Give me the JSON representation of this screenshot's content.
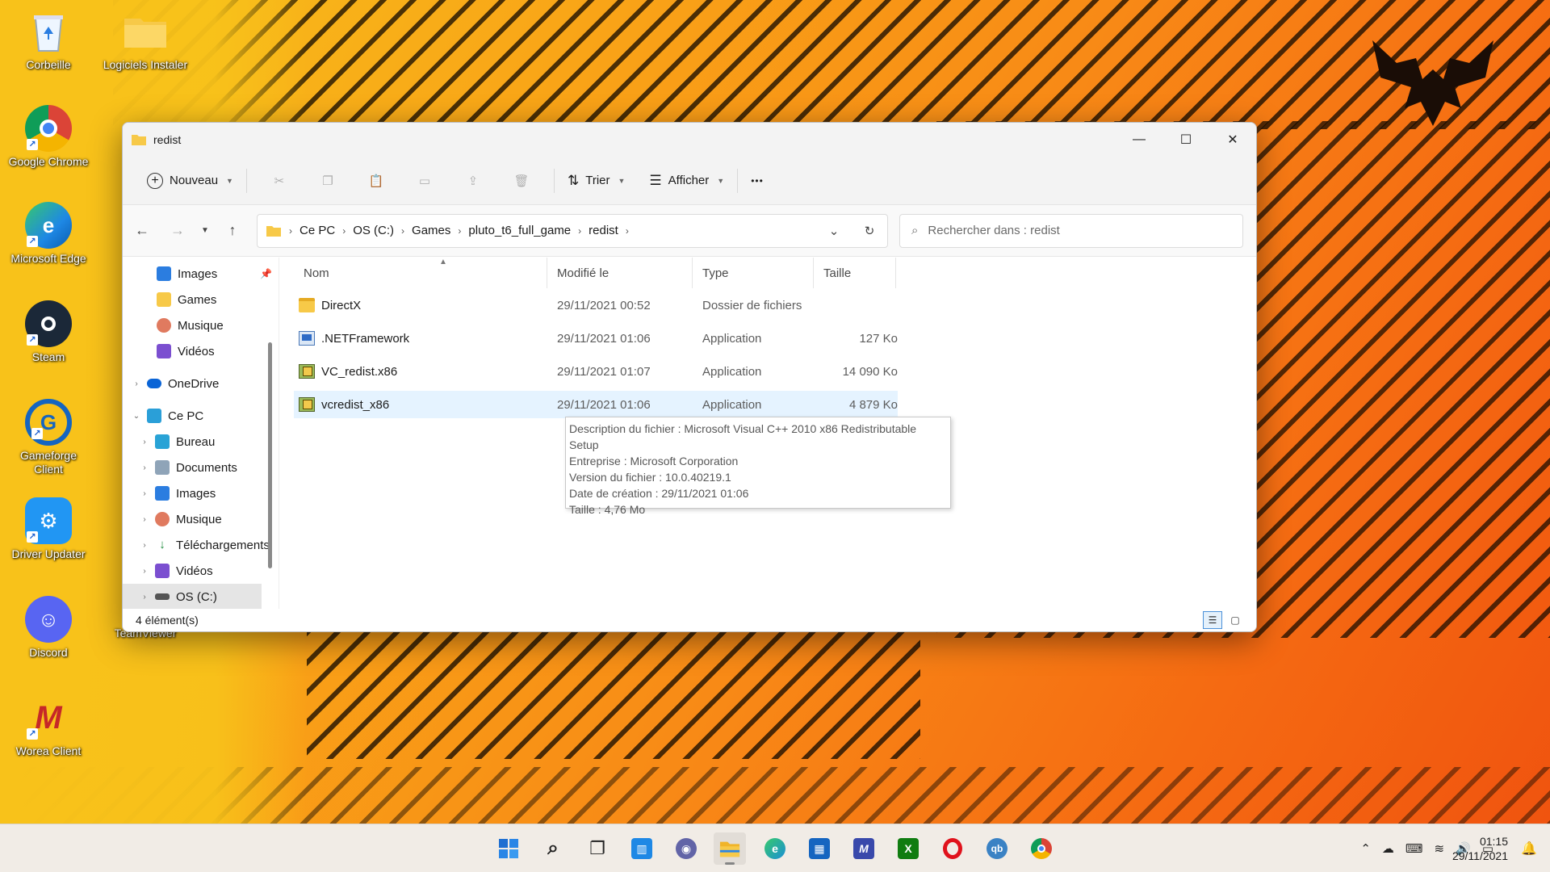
{
  "desktop": {
    "icons": [
      {
        "label": "Corbeille",
        "icon": "recycle-bin-icon",
        "color": "#ffffff"
      },
      {
        "label": "Logiciels Instaler",
        "icon": "folder-icon",
        "color": "#f7c948"
      },
      {
        "label": "Google Chrome",
        "icon": "chrome-icon",
        "color": "#db4437"
      },
      {
        "label": "Microsoft Edge",
        "icon": "edge-icon",
        "color": "#1e88e5"
      },
      {
        "label": "Steam",
        "icon": "steam-icon",
        "color": "#1b2838"
      },
      {
        "label": "Gameforge Client",
        "icon": "gameforge-icon",
        "color": "#1565c0"
      },
      {
        "label": "Driver Updater",
        "icon": "driver-updater-icon",
        "color": "#2196f3"
      },
      {
        "label": "Discord",
        "icon": "discord-icon",
        "color": "#5865f2"
      },
      {
        "label": "TeamViewer",
        "icon": "teamviewer-icon",
        "color": "#0e8ee9"
      },
      {
        "label": "Worea Client",
        "icon": "worea-icon",
        "color": "#c62828"
      }
    ]
  },
  "window": {
    "title": "redist",
    "toolbar": {
      "new_label": "Nouveau",
      "sort_label": "Trier",
      "view_label": "Afficher",
      "more_label": "•••"
    },
    "breadcrumb": [
      "Ce PC",
      "OS (C:)",
      "Games",
      "pluto_t6_full_game",
      "redist"
    ],
    "search_placeholder": "Rechercher dans : redist",
    "nav": {
      "quick": [
        {
          "label": "Images",
          "icon": "images-icon",
          "color": "#2b7de0",
          "pinned": true
        },
        {
          "label": "Games",
          "icon": "folder-icon",
          "color": "#f7c948"
        },
        {
          "label": "Musique",
          "icon": "music-icon",
          "color": "#e07a5f"
        },
        {
          "label": "Vidéos",
          "icon": "videos-icon",
          "color": "#7b4fd0"
        }
      ],
      "onedrive": {
        "label": "OneDrive",
        "icon": "onedrive-icon",
        "color": "#0a64d6"
      },
      "this_pc": {
        "label": "Ce PC",
        "icon": "pc-icon",
        "color": "#2a9fd8"
      },
      "pc_children": [
        {
          "label": "Bureau",
          "icon": "desktop-icon",
          "color": "#29a3d6"
        },
        {
          "label": "Documents",
          "icon": "documents-icon",
          "color": "#8fa4b8"
        },
        {
          "label": "Images",
          "icon": "images-icon",
          "color": "#2b7de0"
        },
        {
          "label": "Musique",
          "icon": "music-icon",
          "color": "#e07a5f"
        },
        {
          "label": "Téléchargements",
          "icon": "downloads-icon",
          "color": "#1c8a3c"
        },
        {
          "label": "Vidéos",
          "icon": "videos-icon",
          "color": "#7b4fd0"
        },
        {
          "label": "OS (C:)",
          "icon": "drive-icon",
          "color": "#555555",
          "selected": true
        }
      ]
    },
    "columns": {
      "name": "Nom",
      "modified": "Modifié le",
      "type": "Type",
      "size": "Taille"
    },
    "files": [
      {
        "name": "DirectX",
        "modified": "29/11/2021 00:52",
        "type": "Dossier de fichiers",
        "size": "",
        "icon": "folder"
      },
      {
        "name": ".NETFramework",
        "modified": "29/11/2021 01:06",
        "type": "Application",
        "size": "127 Ko",
        "icon": "app"
      },
      {
        "name": "VC_redist.x86",
        "modified": "29/11/2021 01:07",
        "type": "Application",
        "size": "14 090 Ko",
        "icon": "setup"
      },
      {
        "name": "vcredist_x86",
        "modified": "29/11/2021 01:06",
        "type": "Application",
        "size": "4 879 Ko",
        "icon": "setup",
        "hovered": true
      }
    ],
    "tooltip": {
      "lines": [
        "Description du fichier : Microsoft Visual C++ 2010  x86 Redistributable",
        "Setup",
        "Entreprise : Microsoft Corporation",
        "Version du fichier : 10.0.40219.1",
        "Date de création : 29/11/2021 01:06",
        "Taille : 4,76 Mo"
      ]
    },
    "status": "4 élément(s)"
  },
  "taskbar": {
    "apps": [
      {
        "name": "start-icon",
        "glyph": "⊞",
        "color": "#1f6fd1"
      },
      {
        "name": "search-icon",
        "glyph": "⌕",
        "color": "#222222"
      },
      {
        "name": "task-view-icon",
        "glyph": "❐",
        "color": "#222222"
      },
      {
        "name": "widgets-icon",
        "glyph": "▥",
        "color": "#1e88e5"
      },
      {
        "name": "chat-icon",
        "glyph": "◉",
        "color": "#6264a7"
      },
      {
        "name": "file-explorer-icon",
        "glyph": "▬",
        "color": "#f0b429",
        "active": true
      },
      {
        "name": "edge-icon",
        "glyph": "e",
        "color": "#1b8fd6"
      },
      {
        "name": "store-icon",
        "glyph": "▦",
        "color": "#1565c0"
      },
      {
        "name": "app-icon",
        "glyph": "M",
        "color": "#3949ab"
      },
      {
        "name": "xbox-icon",
        "glyph": "X",
        "color": "#107c10"
      },
      {
        "name": "opera-icon",
        "glyph": "O",
        "color": "#e0121c"
      },
      {
        "name": "qbittorrent-icon",
        "glyph": "qb",
        "color": "#3b82c4"
      },
      {
        "name": "chrome-icon",
        "glyph": "●",
        "color": "#db4437"
      }
    ],
    "time": "01:15",
    "date": "29/11/2021"
  }
}
